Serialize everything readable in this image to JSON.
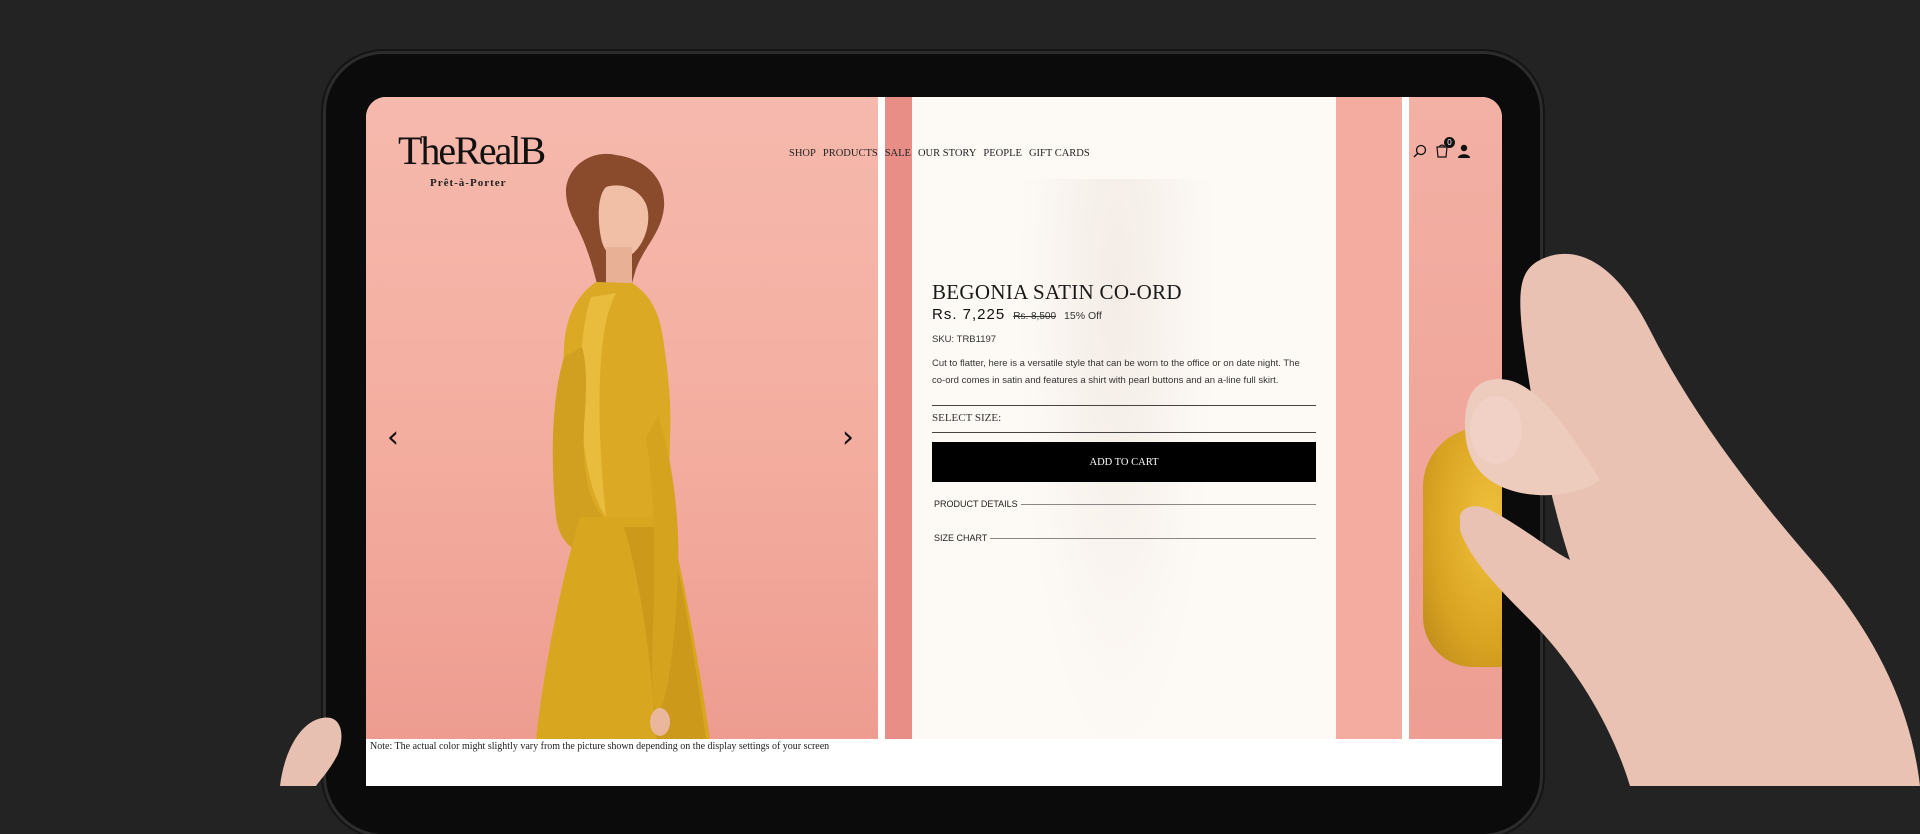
{
  "brand": {
    "name": "TheRealB",
    "tagline": "Prêt-à-Porter"
  },
  "nav": {
    "items": [
      "SHOP",
      "PRODUCTS",
      "SALE",
      "OUR STORY",
      "PEOPLE",
      "GIFT CARDS"
    ]
  },
  "header_icons": {
    "search": "search-icon",
    "cart": "cart-icon",
    "cart_count": "0",
    "account": "user-icon"
  },
  "product": {
    "title": "BEGONIA SATIN CO-ORD",
    "price": "Rs. 7,225",
    "original_price": "Rs. 8,500",
    "discount": "15% Off",
    "sku": "SKU: TRB1197",
    "description": "Cut to flatter, here is a versatile style that can be worn to the office or on date night. The co-ord comes in satin and features a shirt with pearl buttons and an a-line full skirt.",
    "size_label": "SELECT SIZE:",
    "add_to_cart": "ADD TO CART",
    "accordions": [
      "PRODUCT DETAILS",
      "SIZE CHART"
    ]
  },
  "carousel": {
    "prev_icon": "chevron-left-icon",
    "next_icon": "chevron-right-icon"
  },
  "note": "Note: The actual color might slightly vary from the picture shown depending on the display settings of your screen",
  "colors": {
    "background": "#232323",
    "pink_panel": "#f3ad9f",
    "info_panel": "#fdfaf6",
    "outfit": "#dca924",
    "button": "#000000"
  }
}
